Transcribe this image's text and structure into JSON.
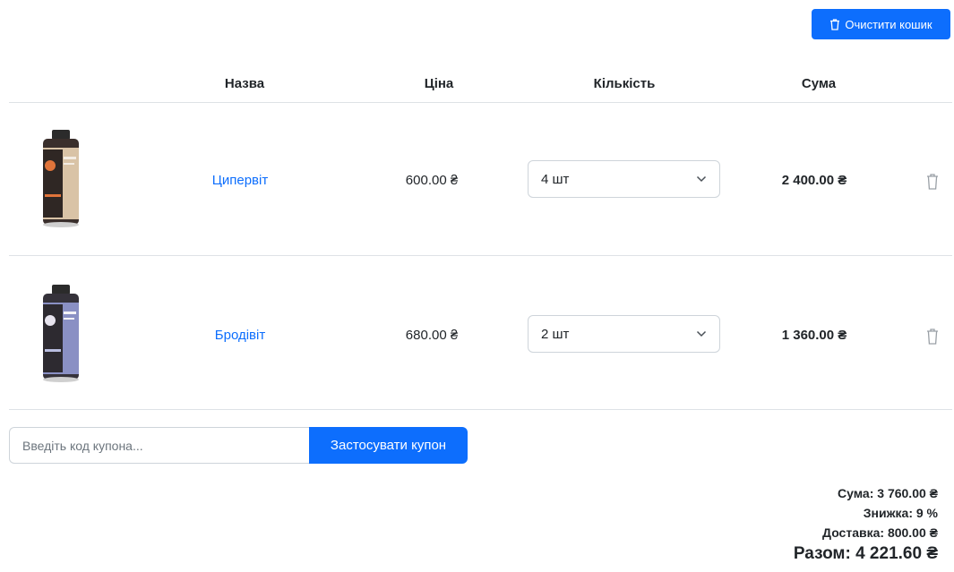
{
  "toolbar": {
    "clear_cart_label": "Очистити кошик"
  },
  "table": {
    "headers": {
      "name": "Назва",
      "price": "Ціна",
      "quantity": "Кількість",
      "sum": "Сума"
    },
    "rows": [
      {
        "name": "Ципервіт",
        "price": "600.00 ₴",
        "quantity": "4 шт",
        "sum": "2 400.00 ₴",
        "label_color": "#d9c3a6"
      },
      {
        "name": "Бродівіт",
        "price": "680.00 ₴",
        "quantity": "2 шт",
        "sum": "1 360.00 ₴",
        "label_color": "#8a90c4"
      }
    ]
  },
  "coupon": {
    "placeholder": "Введіть код купона...",
    "apply_label": "Застосувати купон"
  },
  "totals": {
    "subtotal": "Сума: 3 760.00 ₴",
    "discount": "Знижка: 9 %",
    "delivery": "Доставка: 800.00 ₴",
    "total": "Разом: 4 221.60 ₴"
  },
  "colors": {
    "primary": "#0d6efd",
    "divider": "#dee2e6"
  }
}
